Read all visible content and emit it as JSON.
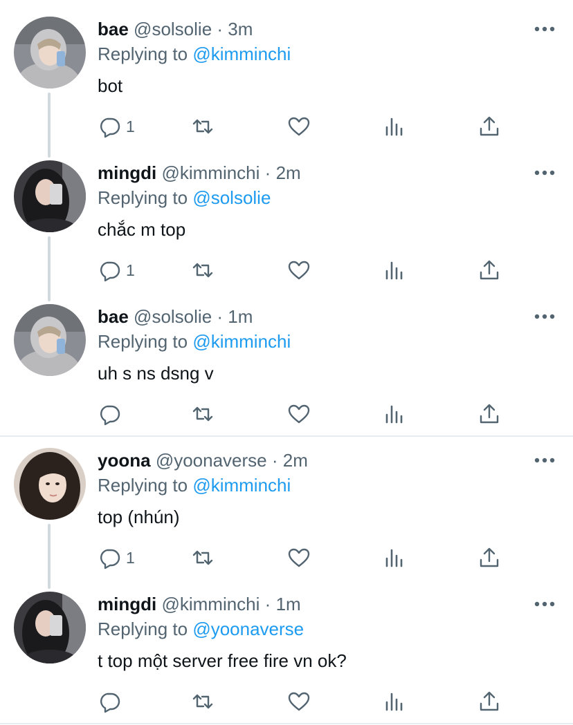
{
  "replying_prefix": "Replying to",
  "tweets": [
    {
      "name": "bae",
      "handle": "@solsolie",
      "sep": "·",
      "time": "3m",
      "replying_to": "@kimminchi",
      "text": "bot",
      "reply_count": "1",
      "avatar": "avatar-gray-hoodie-selfie"
    },
    {
      "name": "mingdi",
      "handle": "@kimminchi",
      "sep": "·",
      "time": "2m",
      "replying_to": "@solsolie",
      "text": "chắc m top",
      "reply_count": "1",
      "avatar": "avatar-dark-hair-mirror-selfie"
    },
    {
      "name": "bae",
      "handle": "@solsolie",
      "sep": "·",
      "time": "1m",
      "replying_to": "@kimminchi",
      "text": "uh s ns dsng v",
      "reply_count": "",
      "avatar": "avatar-gray-hoodie-selfie"
    },
    {
      "name": "yoona",
      "handle": "@yoonaverse",
      "sep": "·",
      "time": "2m",
      "replying_to": "@kimminchi",
      "text": "top (nhún)",
      "reply_count": "1",
      "avatar": "avatar-long-hair-portrait"
    },
    {
      "name": "mingdi",
      "handle": "@kimminchi",
      "sep": "·",
      "time": "1m",
      "replying_to": "@yoonaverse",
      "text": "t top một server free fire vn ok?",
      "reply_count": "",
      "avatar": "avatar-dark-hair-mirror-selfie"
    }
  ],
  "icons": {
    "reply": "reply-icon",
    "retweet": "retweet-icon",
    "like": "heart-icon",
    "views": "views-icon",
    "share": "share-icon",
    "more": "more-icon"
  },
  "colors": {
    "text": "#0f1419",
    "secondary": "#536471",
    "mention": "#1d9bf0",
    "thread_line": "#cfd9de",
    "divider": "#e7ecef"
  }
}
